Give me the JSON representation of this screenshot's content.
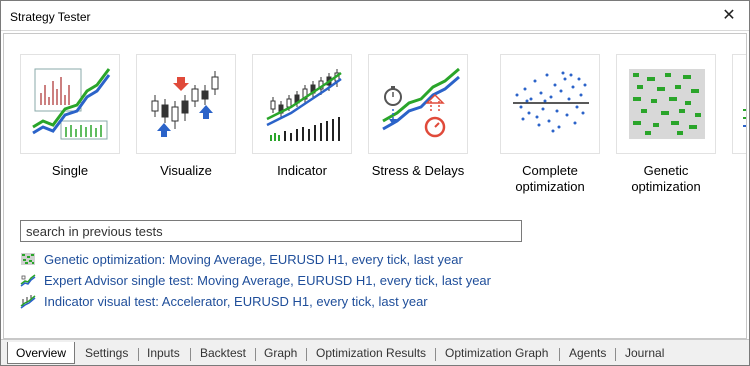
{
  "window": {
    "title": "Strategy Tester",
    "close_glyph": "✕"
  },
  "modes": [
    {
      "icon": "single-test-icon",
      "label": "Single"
    },
    {
      "icon": "visualize-icon",
      "label": "Visualize"
    },
    {
      "icon": "indicator-icon",
      "label": "Indicator"
    },
    {
      "icon": "stress-delays-icon",
      "label": "Stress & Delays"
    },
    {
      "icon": "complete-optimization-icon",
      "label_line1": "Complete",
      "label_line2": "optimization"
    },
    {
      "icon": "genetic-optimization-icon",
      "label_line1": "Genetic",
      "label_line2": "optimization"
    }
  ],
  "search": {
    "placeholder": "search in previous tests"
  },
  "recent_tests": [
    {
      "icon": "genetic-test-icon",
      "text": "Genetic optimization: Moving Average, EURUSD H1, every tick, last year"
    },
    {
      "icon": "expert-test-icon",
      "text": "Expert Advisor single test: Moving Average, EURUSD H1, every tick, last year"
    },
    {
      "icon": "indicator-test-icon",
      "text": "Indicator visual test: Accelerator, EURUSD H1, every tick, last year"
    }
  ],
  "tabs": [
    "Overview",
    "Settings",
    "Inputs",
    "Backtest",
    "Graph",
    "Optimization Results",
    "Optimization Graph",
    "Agents",
    "Journal"
  ],
  "active_tab": "Overview",
  "colors": {
    "link": "#1f4e9a",
    "chart_blue": "#2b63c9",
    "chart_green": "#2aa52a",
    "arrow_red": "#e04a3a"
  }
}
